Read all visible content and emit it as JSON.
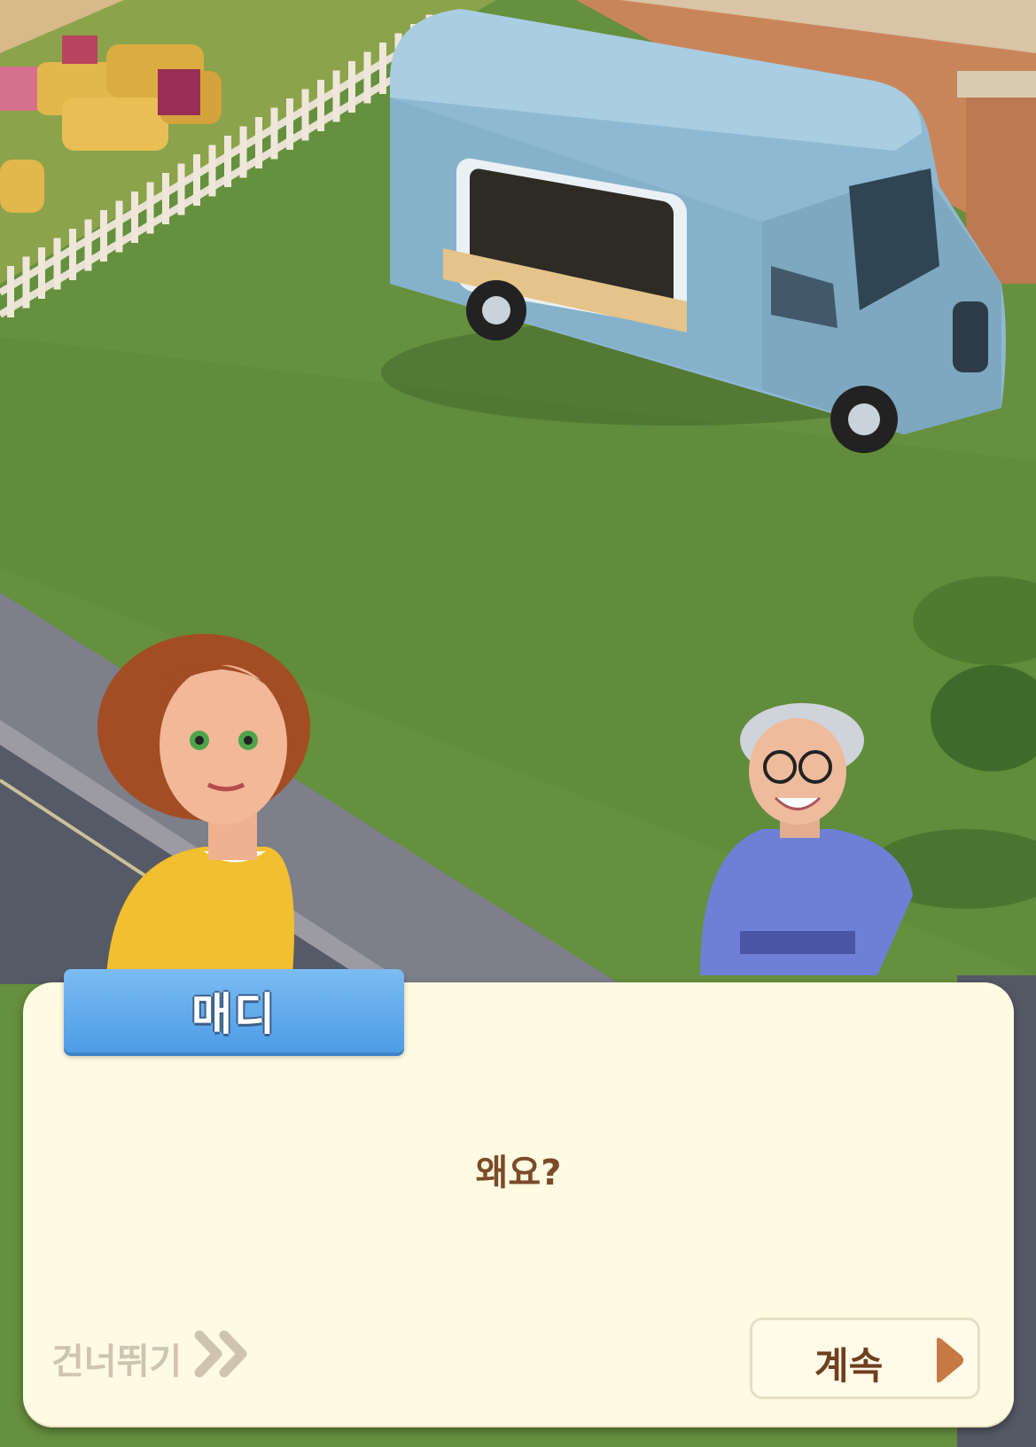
{
  "dialog": {
    "speaker": "매디",
    "text": "왜요?"
  },
  "controls": {
    "skip_label": "건너뛰기",
    "continue_label": "계속"
  },
  "scene": {
    "characters": [
      "maddie",
      "grandma"
    ],
    "objects": [
      "food-truck",
      "fence",
      "hay-bales",
      "road",
      "grass"
    ]
  },
  "colors": {
    "dialog_bg": "#fffbe2",
    "nameplate": "#5aa6ea",
    "text_brown": "#7b4a2a",
    "skip_gray": "#cfc4ae",
    "truck_blue": "#8fb9d2"
  }
}
